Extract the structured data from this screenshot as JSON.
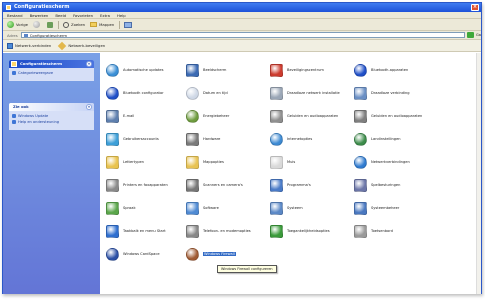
{
  "window": {
    "title": "Configuratiescherm",
    "close_glyph": "×"
  },
  "menubar": {
    "items": [
      "Bestand",
      "Bewerken",
      "Beeld",
      "Favorieten",
      "Extra",
      "Help"
    ]
  },
  "toolbar": {
    "back": "Vorige",
    "search": "Zoeken",
    "folders": "Mappen"
  },
  "addressbar": {
    "label": "Adres",
    "value": "Configuratiescherm",
    "go": "Ga"
  },
  "linkbar": {
    "items": [
      "Netwerk-verbinden",
      "Netwerk-beveiligen"
    ]
  },
  "sidebar": {
    "panel1": {
      "title": "Configuratiescherm",
      "links": [
        "Categorieweergave"
      ]
    },
    "panel2": {
      "title": "Zie ook",
      "links": [
        "Windows Update",
        "Help en ondersteuning"
      ]
    }
  },
  "items": [
    {
      "label": "Automatische updates",
      "icon": "globe-icon",
      "color": "#3a8fd6"
    },
    {
      "label": "Bluetooth configurator",
      "icon": "bluetooth-icon",
      "color": "#1f4fc8"
    },
    {
      "label": "E-mail",
      "icon": "mail-icon",
      "color": "#5e7fae"
    },
    {
      "label": "Gebruikersaccounts",
      "icon": "users-icon",
      "color": "#3d9fd8"
    },
    {
      "label": "Lettertypen",
      "icon": "font-folder-icon",
      "color": "#e9c34e"
    },
    {
      "label": "Printers en faxapparaten",
      "icon": "printer-icon",
      "color": "#8a8a8a"
    },
    {
      "label": "Spraak",
      "icon": "speech-icon",
      "color": "#5aa64a"
    },
    {
      "label": "Taakbalk en menu Start",
      "icon": "taskbar-icon",
      "color": "#2f6fcf"
    },
    {
      "label": "Windows CardSpace",
      "icon": "cardspace-icon",
      "color": "#2a4fa6"
    },
    {
      "label": "Beeldscherm",
      "icon": "display-icon",
      "color": "#3b6ab3"
    },
    {
      "label": "Datum en tijd",
      "icon": "clock-icon",
      "color": "#cfd8e6"
    },
    {
      "label": "Energiebeheer",
      "icon": "power-icon",
      "color": "#6e9c3e"
    },
    {
      "label": "Hardware",
      "icon": "hardware-icon",
      "color": "#7a7a7a"
    },
    {
      "label": "Mappopties",
      "icon": "folder-options-icon",
      "color": "#e8c354"
    },
    {
      "label": "Scanners en camera's",
      "icon": "scanner-icon",
      "color": "#777777"
    },
    {
      "label": "Software",
      "icon": "software-icon",
      "color": "#4f8ad3"
    },
    {
      "label": "Telefoon- en modemopties",
      "icon": "phone-icon",
      "color": "#888888"
    },
    {
      "label": "Windows Firewall",
      "icon": "firewall-icon",
      "color": "#a05a32"
    },
    {
      "label": "Beveiligingscentrum",
      "icon": "shield-icon",
      "color": "#cc3b2e"
    },
    {
      "label": "Draadloze netwerk installatie",
      "icon": "wireless-setup-icon",
      "color": "#9aa6b6"
    },
    {
      "label": "Geluiden en audioapparaten",
      "icon": "speaker-icon",
      "color": "#8f8f8f"
    },
    {
      "label": "Internetopties",
      "icon": "internet-icon",
      "color": "#3d8ad3"
    },
    {
      "label": "Muis",
      "icon": "mouse-icon",
      "color": "#d9d9d9"
    },
    {
      "label": "Programma's",
      "icon": "programs-icon",
      "color": "#4a7bc8"
    },
    {
      "label": "Systeem",
      "icon": "system-icon",
      "color": "#5b88c6"
    },
    {
      "label": "Toegankelijkheidsopties",
      "icon": "accessibility-icon",
      "color": "#3a9a3a"
    },
    {
      "label": "Bluetooth-apparaten",
      "icon": "bluetooth-devices-icon",
      "color": "#1f4fc8"
    },
    {
      "label": "Draadloze verbinding",
      "icon": "wireless-icon",
      "color": "#6a8fc4"
    },
    {
      "label": "Geluiden en audioapparaten",
      "icon": "audio-icon",
      "color": "#7f7f7f"
    },
    {
      "label": "Landinstellingen",
      "icon": "regional-icon",
      "color": "#3c8c4a"
    },
    {
      "label": "Netwerkverbindingen",
      "icon": "network-icon",
      "color": "#2f7bd0"
    },
    {
      "label": "Spelbesturingen",
      "icon": "gamepad-icon",
      "color": "#6c76a8"
    },
    {
      "label": "Systeembeheer",
      "icon": "admin-tools-icon",
      "color": "#4a78c0"
    },
    {
      "label": "Toetsenbord",
      "icon": "keyboard-icon",
      "color": "#9a9a9a"
    }
  ],
  "selected_item": "Windows Firewall",
  "tooltip": "Windows Firewall configureren"
}
